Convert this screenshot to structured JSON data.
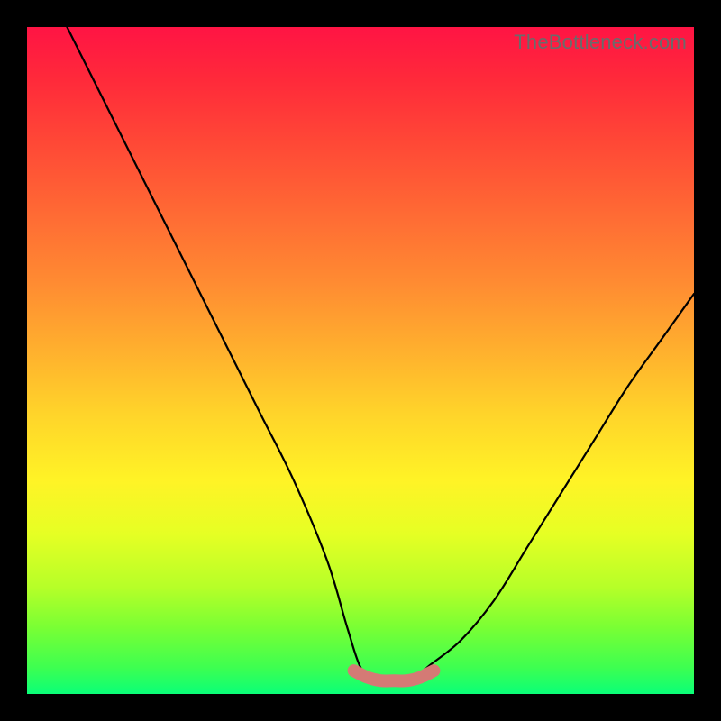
{
  "watermark": "TheBottleneck.com",
  "chart_data": {
    "type": "line",
    "title": "",
    "xlabel": "",
    "ylabel": "",
    "xlim": [
      0,
      100
    ],
    "ylim": [
      0,
      100
    ],
    "series": [
      {
        "name": "bottleneck-curve",
        "x": [
          6,
          10,
          15,
          20,
          25,
          30,
          35,
          40,
          45,
          48,
          50,
          52,
          55,
          58,
          60,
          65,
          70,
          75,
          80,
          85,
          90,
          95,
          100
        ],
        "y": [
          100,
          92,
          82,
          72,
          62,
          52,
          42,
          32,
          20,
          10,
          4,
          2,
          2,
          2,
          4,
          8,
          14,
          22,
          30,
          38,
          46,
          53,
          60
        ]
      },
      {
        "name": "valley-highlight",
        "x": [
          49,
          51,
          53,
          55,
          57,
          59,
          61
        ],
        "y": [
          3.5,
          2.5,
          2,
          2,
          2,
          2.5,
          3.5
        ]
      }
    ],
    "colors": {
      "curve": "#000000",
      "highlight": "#d47a75"
    }
  }
}
